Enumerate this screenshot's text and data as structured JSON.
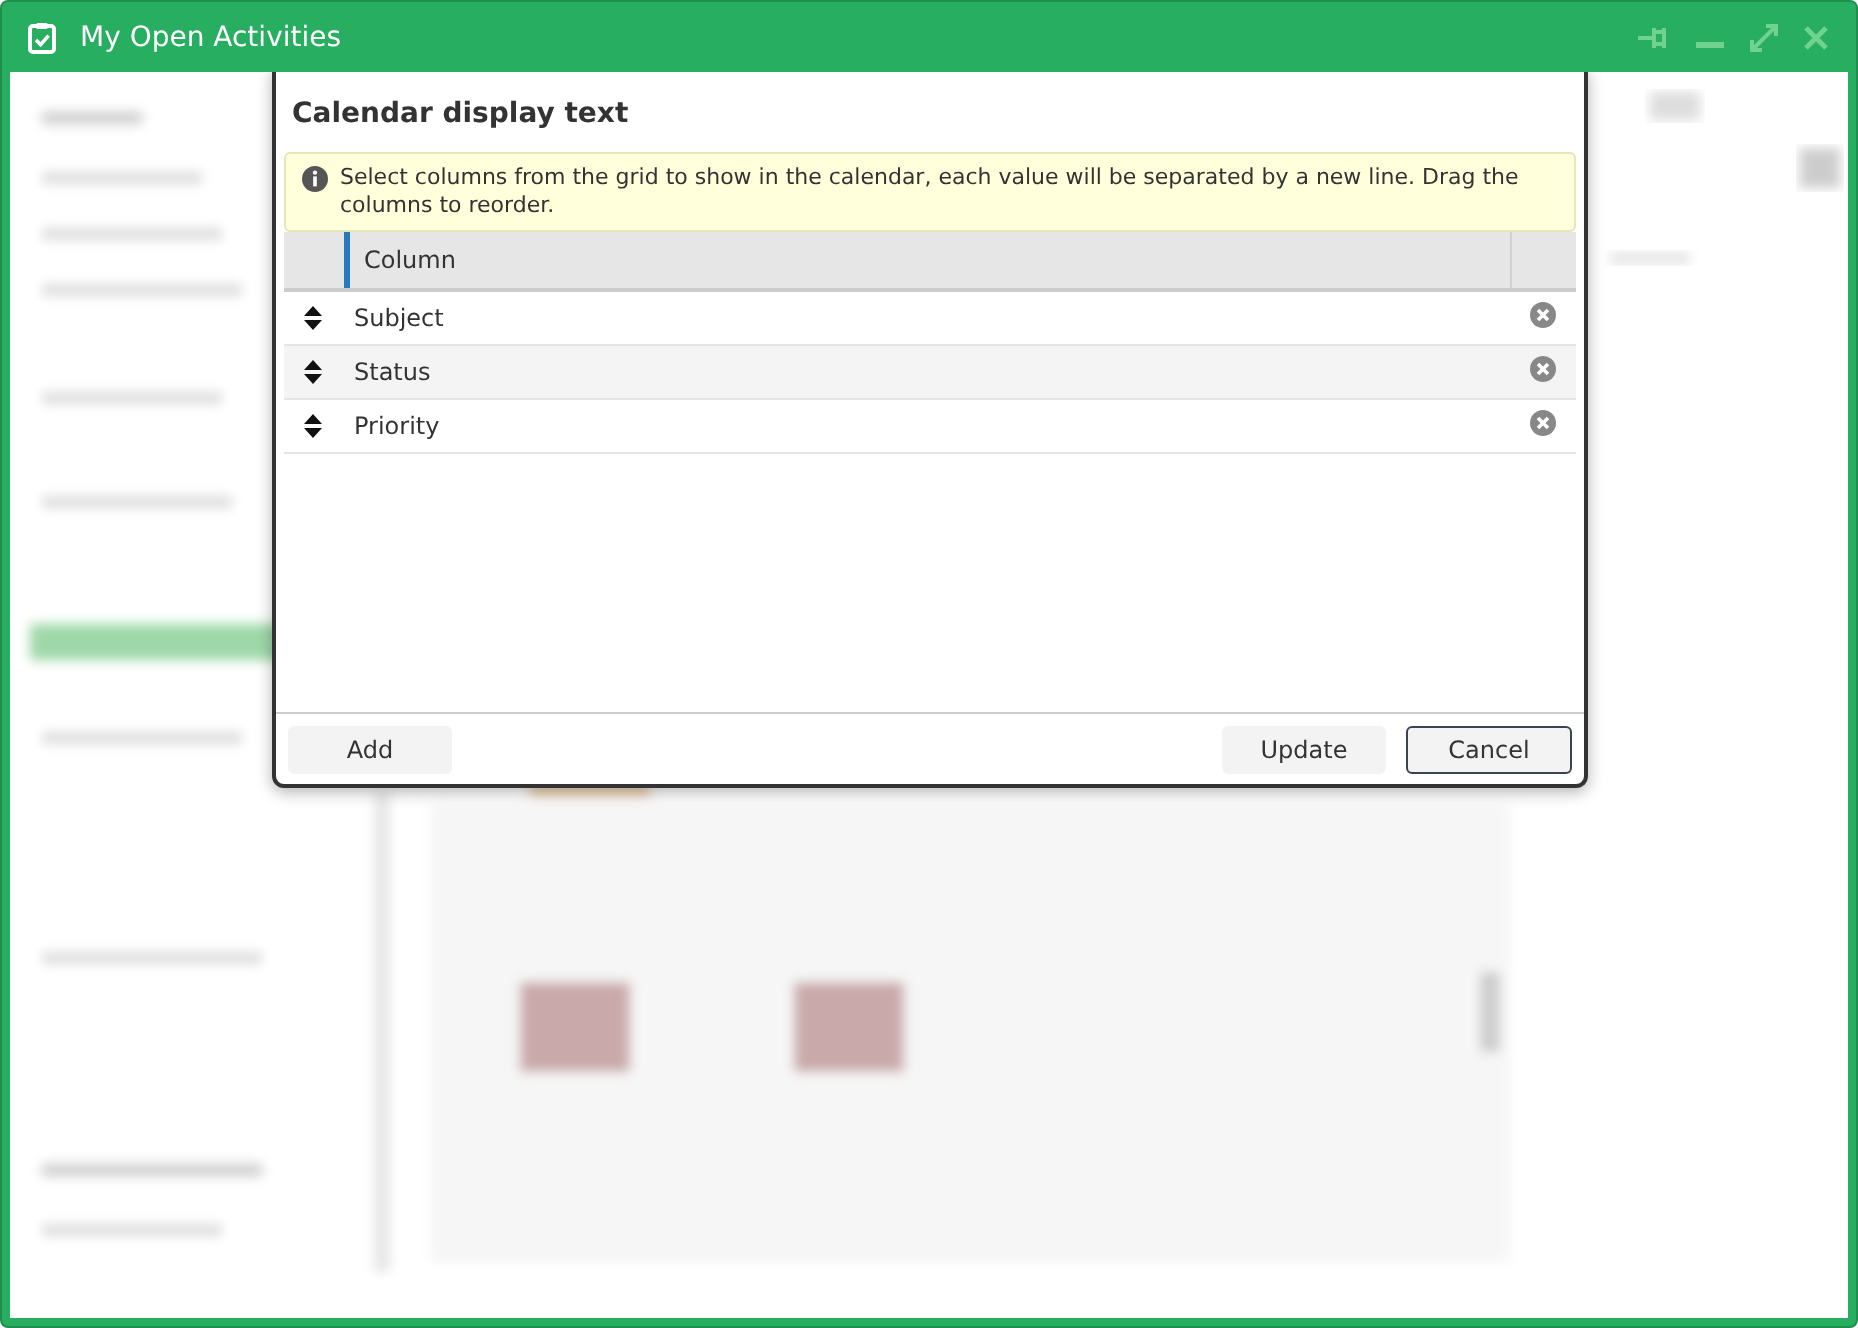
{
  "window": {
    "title": "My Open Activities"
  },
  "dialog": {
    "title": "Calendar display text",
    "note": "Select columns from the grid to show in the calendar, each value will be separated by a new line. Drag the columns to reorder.",
    "grid": {
      "columns": [
        "Column"
      ],
      "rows": [
        {
          "label": "Subject"
        },
        {
          "label": "Status"
        },
        {
          "label": "Priority"
        }
      ]
    },
    "buttons": [
      {
        "label": "Add",
        "kind": "secondary"
      },
      {
        "label": "Update",
        "kind": "secondary"
      },
      {
        "label": "Cancel",
        "kind": "primary"
      }
    ]
  }
}
